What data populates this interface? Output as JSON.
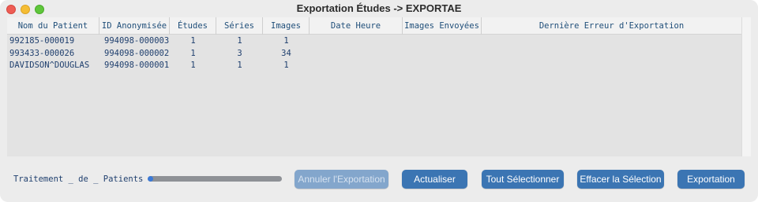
{
  "window": {
    "title": "Exportation Études -> EXPORTAE"
  },
  "table": {
    "columns": [
      "Nom du Patient",
      "ID Anonymisée",
      "Études",
      "Séries",
      "Images",
      "Date Heure",
      "Images Envoyées",
      "Dernière Erreur d'Exportation"
    ],
    "rows": [
      [
        "992185-000019",
        "994098-000003",
        "1",
        "1",
        "1",
        "",
        "",
        ""
      ],
      [
        "993433-000026",
        "994098-000002",
        "1",
        "3",
        "34",
        "",
        "",
        ""
      ],
      [
        "DAVIDSON^DOUGLAS",
        "994098-000001",
        "1",
        "1",
        "1",
        "",
        "",
        ""
      ]
    ]
  },
  "footer": {
    "status_text": "Traitement _ de _ Patients",
    "progress": 0.03,
    "buttons": {
      "cancel_export": "Annuler l'Exportation",
      "refresh": "Actualiser",
      "select_all": "Tout Sélectionner",
      "clear_selection": "Effacer la Sélection",
      "export": "Exportation"
    }
  },
  "colors": {
    "accent": "#3b75b3",
    "accent_disabled": "#83a6cc",
    "table_text": "#1f3f6e"
  }
}
